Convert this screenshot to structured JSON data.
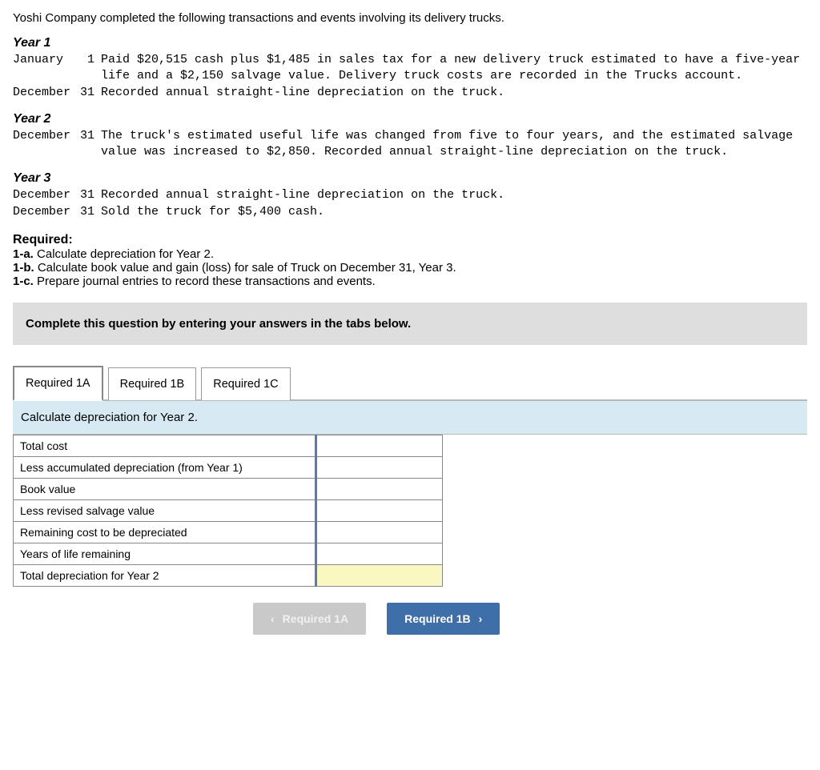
{
  "intro": "Yoshi Company completed the following transactions and events involving its delivery trucks.",
  "years": [
    {
      "label": "Year 1",
      "items": [
        {
          "date_m": "January",
          "date_d": "1",
          "text": "Paid $20,515 cash plus $1,485 in sales tax for a new delivery truck estimated to have a five-year life and a $2,150 salvage value. Delivery truck costs are recorded in the Trucks account."
        },
        {
          "date_m": "December",
          "date_d": "31",
          "text": "Recorded annual straight-line depreciation on the truck."
        }
      ]
    },
    {
      "label": "Year 2",
      "items": [
        {
          "date_m": "December",
          "date_d": "31",
          "text": "The truck's estimated useful life was changed from five to four years, and the estimated salvage value was increased to $2,850. Recorded annual straight-line depreciation on the truck."
        }
      ]
    },
    {
      "label": "Year 3",
      "items": [
        {
          "date_m": "December",
          "date_d": "31",
          "text": "Recorded annual straight-line depreciation on the truck."
        },
        {
          "date_m": "December",
          "date_d": "31",
          "text": "Sold the truck for $5,400 cash."
        }
      ]
    }
  ],
  "required": {
    "head": "Required:",
    "items": [
      {
        "tag": "1-a.",
        "text": "Calculate depreciation for Year 2."
      },
      {
        "tag": "1-b.",
        "text": "Calculate book value and gain (loss) for sale of Truck on December 31, Year 3."
      },
      {
        "tag": "1-c.",
        "text": "Prepare journal entries to record these transactions and events."
      }
    ]
  },
  "instruction": "Complete this question by entering your answers in the tabs below.",
  "tabs": [
    {
      "label": "Required 1A",
      "active": true
    },
    {
      "label": "Required 1B",
      "active": false
    },
    {
      "label": "Required 1C",
      "active": false
    }
  ],
  "prompt": "Calculate depreciation for Year 2.",
  "rows": [
    {
      "label": "Total cost",
      "value": ""
    },
    {
      "label": "Less accumulated depreciation (from Year 1)",
      "value": ""
    },
    {
      "label": "Book value",
      "value": ""
    },
    {
      "label": "Less revised salvage value",
      "value": ""
    },
    {
      "label": "Remaining cost to be depreciated",
      "value": ""
    },
    {
      "label": "Years of life remaining",
      "value": ""
    },
    {
      "label": "Total depreciation for Year 2",
      "value": "",
      "active": true
    }
  ],
  "nav": {
    "prev": "Required 1A",
    "next": "Required 1B"
  }
}
